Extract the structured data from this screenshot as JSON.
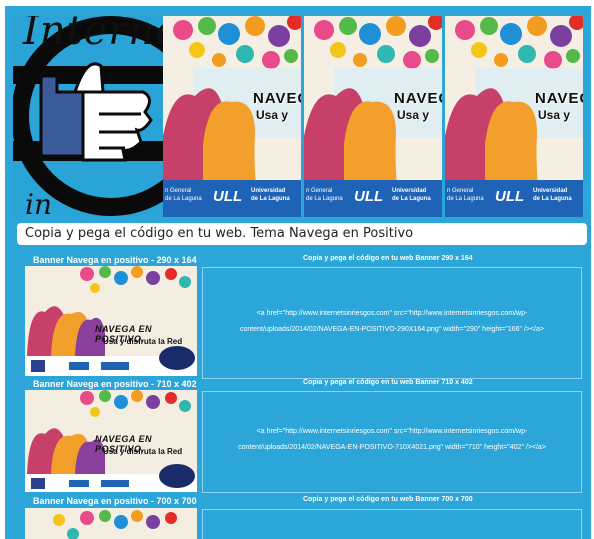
{
  "header": {
    "logo": {
      "text_top": "Interne",
      "text_bottom": "in riesgos"
    },
    "promo_tiles": [
      {
        "navega": "NAVEGA",
        "usa": "Usa y",
        "band_left": "n General\nde La Laguna",
        "band_ull": "ULL",
        "band_uni": "Universidad\nde La Laguna"
      },
      {
        "navega": "NAVEGA",
        "usa": "Usa y",
        "band_left": "n General\nde La Laguna",
        "band_ull": "ULL",
        "band_uni": "Universidad\nde La Laguna"
      },
      {
        "navega": "NAVEGA",
        "usa": "Usa y",
        "band_left": "n General\nde La Laguna",
        "band_ull": "ULL",
        "band_uni": "Universidad\nde La Laguna"
      }
    ]
  },
  "section_title": "Copia y pega el código en tu web. Tema Navega en Positivo",
  "rows": [
    {
      "label": "Banner Navega en positivo - 290 x 164",
      "code_title": "Copia y pega el código en tu web Banner 290 x 164",
      "code_line1": "<a href=\"http://www.internetsinriesgos.com\" src=\"http://www.internetsinriesgos.com/wp-",
      "code_line2": "content/uploads/2014/02/NAVEGA-EN-POSITIVO-290X164.png\" width=\"290\" height=\"166\" /></a>",
      "thumb_title": "NAVEGA EN POSITIVO.",
      "thumb_sub": "Usa y disfruta la Red"
    },
    {
      "label": "Banner Navega en positivo - 710 x 402",
      "code_title": "Copia y pega el código en tu web Banner 710 x 402",
      "code_line1": "<a href=\"http://www.internetsinriesgos.com\" src=\"http://www.internetsinriesgos.com/wp-",
      "code_line2": "content/uploads/2014/02/NAVEGA-EN-POSITIVO-710X4021.png\" width=\"710\" height=\"402\" /></a>",
      "thumb_title": "NAVEGA EN POSITIVO.",
      "thumb_sub": "Usa y disfruta la Red"
    },
    {
      "label": "Banner Navega en positivo - 700 x 700",
      "code_title": "Copia y pega el código en tu web Banner 700 x 700"
    }
  ],
  "colors": {
    "page_blue": "#2ca6d8",
    "band_blue": "#1f63b6",
    "white": "#ffffff"
  }
}
